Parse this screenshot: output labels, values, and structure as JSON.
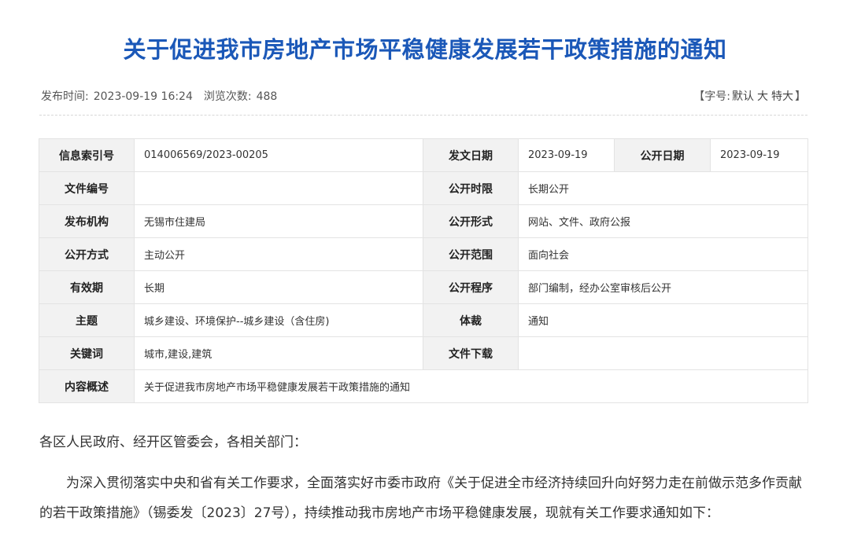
{
  "title": "关于促进我市房地产市场平稳健康发展若干政策措施的通知",
  "meta": {
    "publish_label": "发布时间:",
    "publish_time": "2023-09-19 16:24",
    "views_label": "浏览次数:",
    "views": "488",
    "font_open": "【字号:",
    "font_default": "默认",
    "font_large": "大",
    "font_xlarge": "特大",
    "font_close": "】"
  },
  "info": {
    "index_label": "信息索引号",
    "index_value": "014006569/2023-00205",
    "date_label": "发文日期",
    "date_value": "2023-09-19",
    "pub_date_label": "公开日期",
    "pub_date_value": "2023-09-19",
    "doc_no_label": "文件编号",
    "doc_no_value": "",
    "pub_limit_label": "公开时限",
    "pub_limit_value": "长期公开",
    "org_label": "发布机构",
    "org_value": "无锡市住建局",
    "pub_form_label": "公开形式",
    "pub_form_value": "网站、文件、政府公报",
    "pub_method_label": "公开方式",
    "pub_method_value": "主动公开",
    "pub_scope_label": "公开范围",
    "pub_scope_value": "面向社会",
    "validity_label": "有效期",
    "validity_value": "长期",
    "procedure_label": "公开程序",
    "procedure_value": "部门编制，经办公室审核后公开",
    "topic_label": "主题",
    "topic_value": "城乡建设、环境保护--城乡建设（含住房)",
    "genre_label": "体裁",
    "genre_value": "通知",
    "keywords_label": "关键词",
    "keywords_value": "城市,建设,建筑",
    "download_label": "文件下载",
    "download_value": "",
    "summary_label": "内容概述",
    "summary_value": "关于促进我市房地产市场平稳健康发展若干政策措施的通知"
  },
  "body": {
    "salutation": "各区人民政府、经开区管委会，各相关部门：",
    "paragraph1": "为深入贯彻落实中央和省有关工作要求，全面落实好市委市政府《关于促进全市经济持续回升向好努力走在前做示范多作贡献的若干政策措施》（锡委发〔2023〕27号），持续推动我市房地产市场平稳健康发展，现就有关工作要求通知如下："
  }
}
